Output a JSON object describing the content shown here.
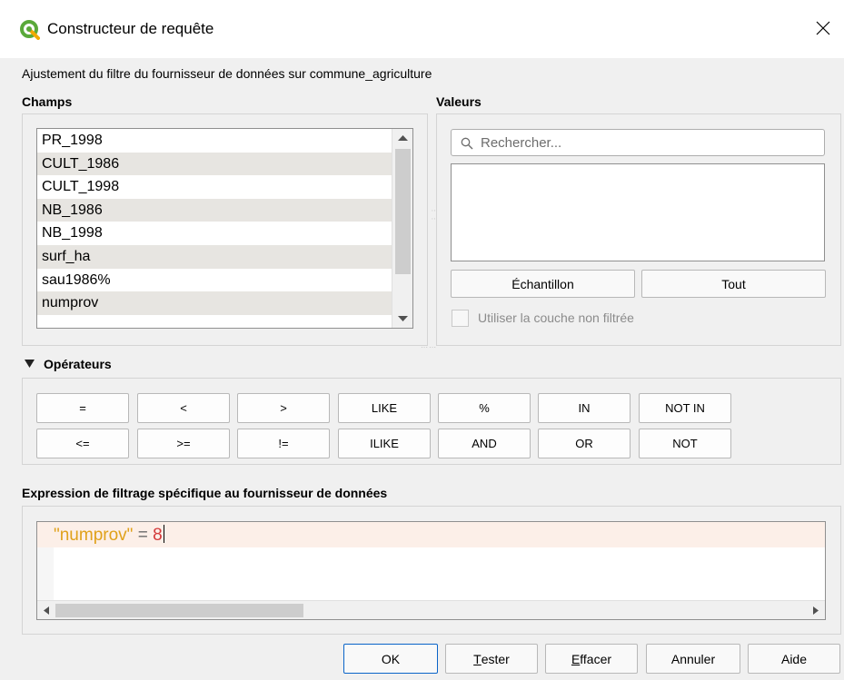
{
  "window": {
    "title": "Constructeur de requête",
    "subtitle": "Ajustement du filtre du fournisseur de données sur commune_agriculture"
  },
  "fields": {
    "label": "Champs",
    "items": [
      "PR_1998",
      "CULT_1986",
      "CULT_1998",
      "NB_1986",
      "NB_1998",
      "surf_ha",
      "sau1986%",
      "numprov"
    ]
  },
  "values": {
    "label": "Valeurs",
    "search_placeholder": "Rechercher...",
    "sample_button": "Échantillon",
    "all_button": "Tout",
    "use_unfiltered_label": "Utiliser la couche non filtrée",
    "use_unfiltered_checked": false
  },
  "operators": {
    "label": "Opérateurs",
    "row1": [
      "=",
      "<",
      ">",
      "LIKE",
      "%",
      "IN",
      "NOT IN"
    ],
    "row2": [
      "<=",
      ">=",
      "!=",
      "ILIKE",
      "AND",
      "OR",
      "NOT"
    ]
  },
  "expression": {
    "label": "Expression de filtrage spécifique au fournisseur de données",
    "field": "\"numprov\"",
    "operator": "=",
    "value": "8"
  },
  "buttons": {
    "ok": "OK",
    "test_first": "T",
    "test_rest": "ester",
    "clear_first": "E",
    "clear_rest": "ffacer",
    "cancel": "Annuler",
    "help": "Aide"
  },
  "colors": {
    "field_token": "#e0a11a",
    "number_token": "#d43a3a",
    "current_line": "#fcefe8",
    "ok_border": "#0a64c8"
  }
}
